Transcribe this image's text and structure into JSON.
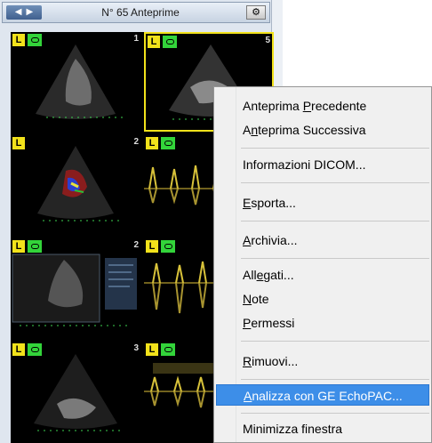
{
  "panel": {
    "title": "N° 65 Anteprime",
    "nav_prev_icon": "chevron-left-icon",
    "nav_next_icon": "chevron-right-icon",
    "settings_icon": "gear-icon"
  },
  "thumbnails": [
    {
      "number": "1",
      "tag": "L",
      "video": true
    },
    {
      "number": "5",
      "tag": "L",
      "video": true,
      "selected": true
    },
    {
      "number": "2",
      "tag": "L",
      "video": false
    },
    {
      "number": "",
      "tag": "L",
      "video": true
    },
    {
      "number": "2",
      "tag": "L",
      "video": true
    },
    {
      "number": "",
      "tag": "L",
      "video": true
    },
    {
      "number": "3",
      "tag": "L",
      "video": true
    },
    {
      "number": "",
      "tag": "L",
      "video": true
    }
  ],
  "context_menu": {
    "items": [
      {
        "pre": "Anteprima ",
        "ul": "P",
        "post": "recedente"
      },
      {
        "pre": "A",
        "ul": "n",
        "post": "teprima Successiva"
      },
      {
        "pre": "Informazioni DICOM...",
        "ul": "",
        "post": ""
      },
      {
        "pre": "",
        "ul": "E",
        "post": "sporta..."
      },
      {
        "pre": "",
        "ul": "A",
        "post": "rchivia..."
      },
      {
        "pre": "All",
        "ul": "e",
        "post": "gati..."
      },
      {
        "pre": "",
        "ul": "N",
        "post": "ote"
      },
      {
        "pre": "",
        "ul": "P",
        "post": "ermessi"
      },
      {
        "pre": "",
        "ul": "R",
        "post": "imuovi..."
      },
      {
        "pre": "",
        "ul": "A",
        "post": "nalizza con GE EchoPAC...",
        "highlighted": true
      },
      {
        "pre": "Minimizza finestra",
        "ul": "",
        "post": ""
      }
    ]
  }
}
